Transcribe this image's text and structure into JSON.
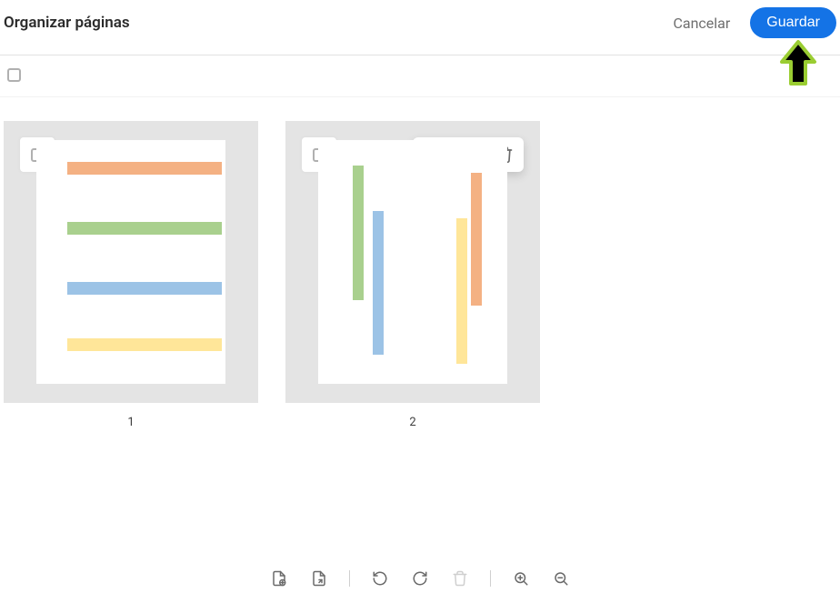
{
  "header": {
    "title": "Organizar páginas",
    "cancel": "Cancelar",
    "save": "Guardar"
  },
  "pages": [
    {
      "number": "1"
    },
    {
      "number": "2"
    }
  ],
  "colors": {
    "accent": "#1473e6"
  },
  "icons": {
    "rotate_ccw": "rotate-ccw",
    "rotate_cw": "rotate-cw",
    "trash": "trash",
    "add_file": "add-file",
    "extract": "extract-page",
    "zoom_in": "zoom-in",
    "zoom_out": "zoom-out"
  }
}
